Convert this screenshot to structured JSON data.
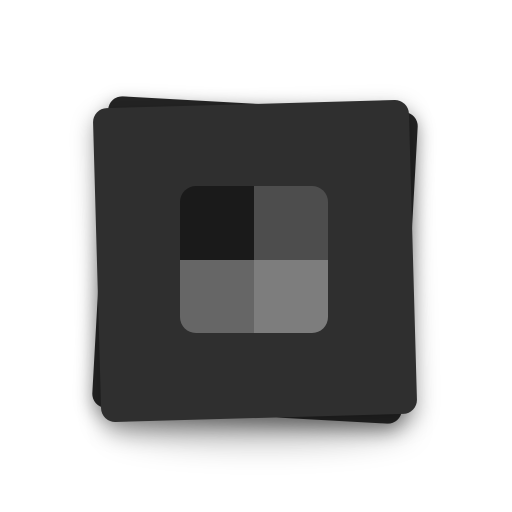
{
  "icon": {
    "name": "stacked-cards-grid-icon",
    "colors": {
      "background": "#ffffff",
      "card_back": "#242424",
      "card_front": "#2f2f2f",
      "quadrant_top_left": "#1a1a1a",
      "quadrant_top_right": "#4d4d4d",
      "quadrant_bottom_left": "#666666",
      "quadrant_bottom_right": "#7d7d7d"
    }
  }
}
